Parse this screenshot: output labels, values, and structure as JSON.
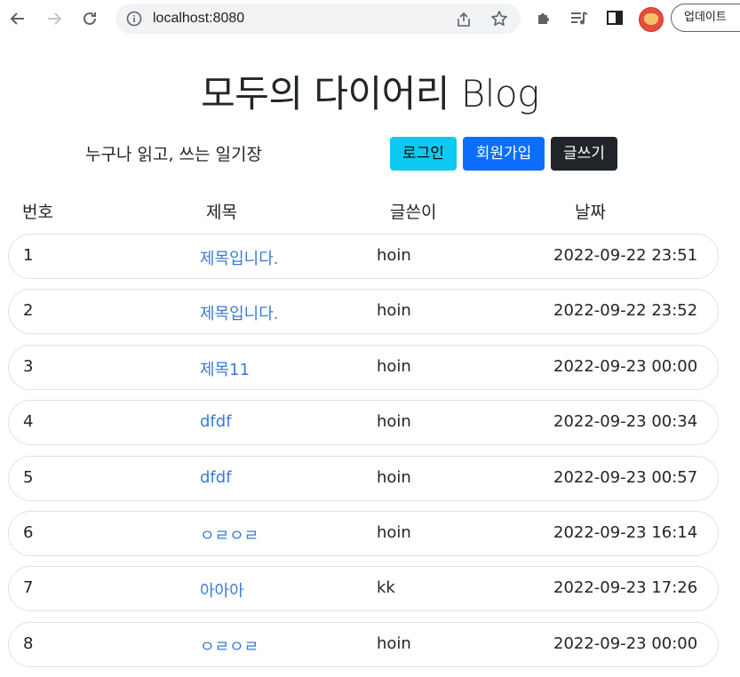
{
  "browser": {
    "url": "localhost:8080",
    "update_label": "업데이트"
  },
  "page": {
    "title": "모두의 다이어리 Blog",
    "subtitle": "누구나 읽고, 쓰는 일기장",
    "buttons": {
      "login": "로그인",
      "signup": "회원가입",
      "write": "글쓰기"
    }
  },
  "table": {
    "headers": {
      "no": "번호",
      "title": "제목",
      "author": "글쓴이",
      "date": "날짜"
    },
    "rows": [
      {
        "no": "1",
        "title": "제목입니다.",
        "author": "hoin",
        "date": "2022-09-22 23:51"
      },
      {
        "no": "2",
        "title": "제목입니다.",
        "author": "hoin",
        "date": "2022-09-22 23:52"
      },
      {
        "no": "3",
        "title": "제목11",
        "author": "hoin",
        "date": "2022-09-23 00:00"
      },
      {
        "no": "4",
        "title": "dfdf",
        "author": "hoin",
        "date": "2022-09-23 00:34"
      },
      {
        "no": "5",
        "title": "dfdf",
        "author": "hoin",
        "date": "2022-09-23 00:57"
      },
      {
        "no": "6",
        "title": "ㅇㄹㅇㄹ",
        "author": "hoin",
        "date": "2022-09-23 16:14"
      },
      {
        "no": "7",
        "title": "아아아",
        "author": "kk",
        "date": "2022-09-23 17:26"
      },
      {
        "no": "8",
        "title": "ㅇㄹㅇㄹ",
        "author": "hoin",
        "date": "2022-09-23 00:00"
      }
    ]
  }
}
